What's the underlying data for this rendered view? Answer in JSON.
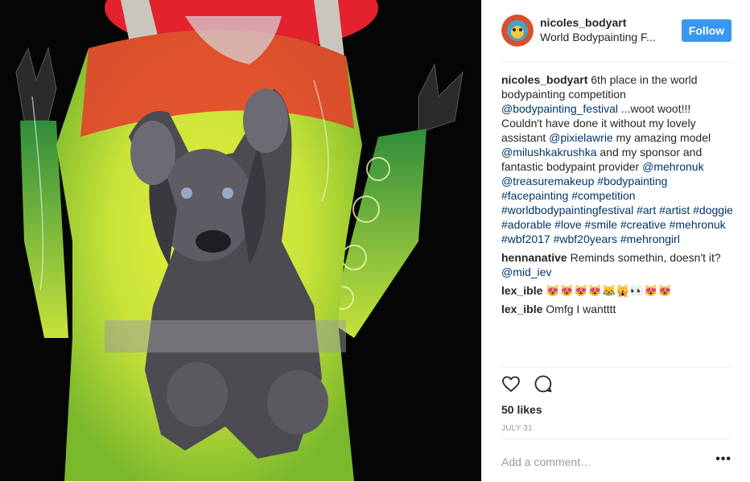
{
  "post": {
    "username": "nicoles_bodyart",
    "location": "World Bodypainting F...",
    "follow_label": "Follow",
    "caption": [
      {
        "text": "6th place in the world bodypainting competition ",
        "link": false
      },
      {
        "text": "@bodypainting_festival",
        "link": true
      },
      {
        "text": " ...woot woot!!! Couldn't have done it without my lovely assistant ",
        "link": false
      },
      {
        "text": "@pixielawrie",
        "link": true
      },
      {
        "text": " my amazing model ",
        "link": false
      },
      {
        "text": "@milushkakrushka",
        "link": true
      },
      {
        "text": " and my sponsor and fantastic bodypaint provider ",
        "link": false
      },
      {
        "text": "@mehronuk",
        "link": true
      },
      {
        "text": " ",
        "link": false
      },
      {
        "text": "@treasuremakeup",
        "link": true
      },
      {
        "text": " ",
        "link": false
      },
      {
        "text": "#bodypainting",
        "link": true
      },
      {
        "text": " ",
        "link": false
      },
      {
        "text": "#facepainting",
        "link": true
      },
      {
        "text": " ",
        "link": false
      },
      {
        "text": "#competition",
        "link": true
      },
      {
        "text": " ",
        "link": false
      },
      {
        "text": "#worldbodypaintingfestival",
        "link": true
      },
      {
        "text": " ",
        "link": false
      },
      {
        "text": "#art",
        "link": true
      },
      {
        "text": " ",
        "link": false
      },
      {
        "text": "#artist",
        "link": true
      },
      {
        "text": " ",
        "link": false
      },
      {
        "text": "#doggie",
        "link": true
      },
      {
        "text": " ",
        "link": false
      },
      {
        "text": "#adorable",
        "link": true
      },
      {
        "text": " ",
        "link": false
      },
      {
        "text": "#love",
        "link": true
      },
      {
        "text": " ",
        "link": false
      },
      {
        "text": "#smile",
        "link": true
      },
      {
        "text": " ",
        "link": false
      },
      {
        "text": "#creative",
        "link": true
      },
      {
        "text": " ",
        "link": false
      },
      {
        "text": "#mehronuk",
        "link": true
      },
      {
        "text": " ",
        "link": false
      },
      {
        "text": "#wbf2017",
        "link": true
      },
      {
        "text": " ",
        "link": false
      },
      {
        "text": "#wbf20years",
        "link": true
      },
      {
        "text": " ",
        "link": false
      },
      {
        "text": "#mehrongirl",
        "link": true
      }
    ],
    "comments": [
      {
        "user": "hennanative",
        "parts": [
          {
            "text": "Reminds somethin, doesn't it? ",
            "link": false
          },
          {
            "text": "@mid_iev",
            "link": true
          }
        ]
      },
      {
        "user": "lex_ible",
        "parts": [
          {
            "text": "😻😻😻😻😹🙀👀😻😻",
            "link": false
          }
        ]
      },
      {
        "user": "lex_ible",
        "parts": [
          {
            "text": "Omfg I wantttt",
            "link": false
          }
        ]
      }
    ],
    "likes": "50 likes",
    "date": "JULY 31",
    "comment_placeholder": "Add a comment…",
    "more_label": "•••",
    "icons": {
      "like": "heart-icon",
      "comment": "comment-icon"
    },
    "accent_color": "#3897f0",
    "link_color": "#003569"
  }
}
